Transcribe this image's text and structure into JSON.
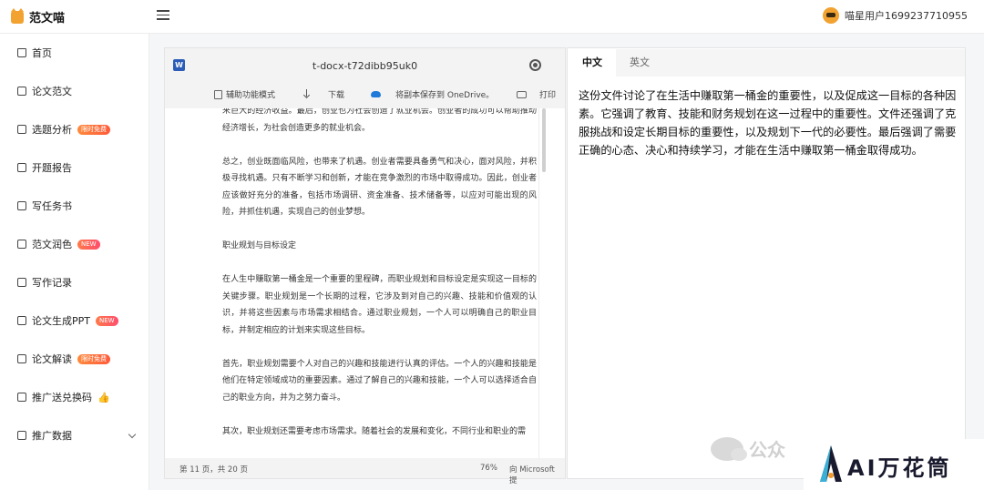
{
  "app": {
    "name": "范文喵"
  },
  "user": {
    "name": "喵星用户1699237710955"
  },
  "sidebar": {
    "items": [
      {
        "label": "首页"
      },
      {
        "label": "论文范文"
      },
      {
        "label": "选题分析",
        "badge": "限时免费"
      },
      {
        "label": "开题报告"
      },
      {
        "label": "写任务书"
      },
      {
        "label": "范文润色",
        "badge": "NEW"
      },
      {
        "label": "写作记录"
      },
      {
        "label": "论文生成PPT",
        "badge": "NEW"
      },
      {
        "label": "论文解读",
        "badge": "限时免费"
      },
      {
        "label": "推广送兑换码",
        "emoji": "👍"
      },
      {
        "label": "推广数据"
      }
    ]
  },
  "doc": {
    "title": "t-docx-t72dibb95uk0",
    "toolbar": {
      "accessibility": "辅助功能模式",
      "download": "下载",
      "onedrive": "将副本保存到 OneDrive。",
      "print": "打印"
    },
    "paragraphs": [
      "来巨大的经济收益。最后，创业也为社会创造了就业机会。创业者的成功可以帮助推动经济增长，为社会创造更多的就业机会。",
      "总之，创业既面临风险，也带来了机遇。创业者需要具备勇气和决心，面对风险，并积极寻找机遇。只有不断学习和创新，才能在竞争激烈的市场中取得成功。因此，创业者应该做好充分的准备，包括市场调研、资金准备、技术储备等，以应对可能出现的风险，并抓住机遇，实现自己的创业梦想。",
      "职业规划与目标设定",
      "在人生中赚取第一桶金是一个重要的里程碑，而职业规划和目标设定是实现这一目标的关键步骤。职业规划是一个长期的过程，它涉及到对自己的兴趣、技能和价值观的认识，并将这些因素与市场需求相结合。通过职业规划，一个人可以明确自己的职业目标，并制定相应的计划来实现这些目标。",
      "首先，职业规划需要个人对自己的兴趣和技能进行认真的评估。一个人的兴趣和技能是他们在特定领域成功的重要因素。通过了解自己的兴趣和技能，一个人可以选择适合自己的职业方向，并为之努力奋斗。",
      "其次，职业规划还需要考虑市场需求。随着社会的发展和变化，不同行业和职业的需"
    ],
    "status": {
      "page": "第 11 页，共 20 页",
      "zoom": "76%",
      "feedback": "向 Microsoft 提"
    }
  },
  "result": {
    "tabs": [
      "中文",
      "英文"
    ],
    "active_tab": "中文",
    "summary": "这份文件讨论了在生活中赚取第一桶金的重要性，以及促成这一目标的各种因素。它强调了教育、技能和财务规划在这一过程中的重要性。文件还强调了克服挑战和设定长期目标的重要性，以及规划下一代的必要性。最后强调了需要正确的心态、决心和持续学习，才能在生活中赚取第一桶金取得成功。"
  },
  "watermark": {
    "text": "公众",
    "brand": "AI万花筒"
  }
}
